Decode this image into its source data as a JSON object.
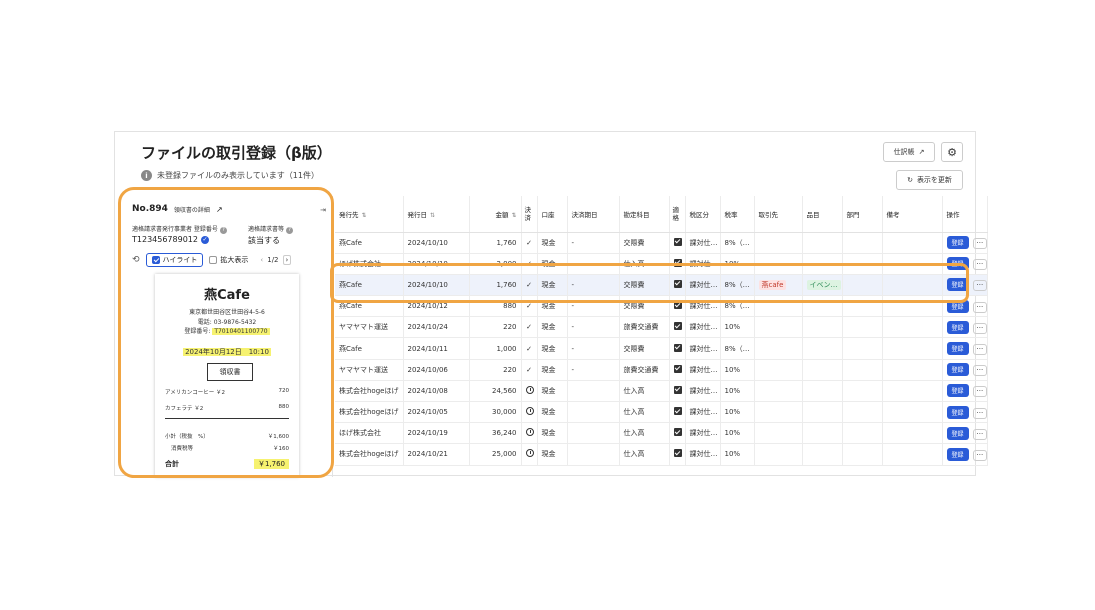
{
  "header": {
    "title": "ファイルの取引登録（β版）",
    "subtitle": "未登録ファイルのみ表示しています（11件）",
    "journal_button": "仕訳帳",
    "refresh_button": "表示を更新"
  },
  "detail": {
    "number": "No.894",
    "receipt_detail": "領収書の詳細",
    "label_issuer_reg": "適格請求書発行事業者 登録番号",
    "label_qualified": "適格請求書等",
    "reg_number": "T123456789012",
    "qualified_value": "該当する",
    "highlight_label": "ハイライト",
    "zoom_label": "拡大表示",
    "page": "1/2"
  },
  "receipt": {
    "store": "燕Cafe",
    "address": "東京都世田谷区世田谷4-5-6",
    "phone": "電話: 03-9876-5432",
    "reg_label": "登録番号:",
    "reg_value": "T7010401100770",
    "date": "2024年10月12日　10:10",
    "title": "領収書",
    "items": [
      {
        "name": "アメリカンコーヒー ￥2",
        "price": "720"
      },
      {
        "name": "カフェラテ ￥2",
        "price": "880"
      }
    ],
    "subtotal_label": "小計（税抜　%）",
    "subtotal": "￥1,600",
    "tax_label": "消費税等",
    "tax": "￥160",
    "total_label": "合計",
    "total": "￥1,760"
  },
  "table": {
    "headers": [
      "発行先",
      "発行日",
      "金額",
      "決済",
      "口座",
      "決済期日",
      "勘定科目",
      "適格",
      "税区分",
      "税率",
      "取引先",
      "品目",
      "部門",
      "備考",
      "操作"
    ],
    "rows": [
      {
        "issuer": "燕Cafe",
        "date": "2024/10/10",
        "amount": "1,760",
        "account": "現金",
        "due": "-",
        "subject": "交際費",
        "tax_cat": "課対仕…",
        "rate": "8%（…",
        "partner": "",
        "item": ""
      },
      {
        "issuer": "ほげ株式会社",
        "date": "2024/10/10",
        "amount": "2,000",
        "account": "現金",
        "due": "-",
        "subject": "仕入高",
        "tax_cat": "課対仕…",
        "rate": "10%",
        "partner": "",
        "item": ""
      },
      {
        "issuer": "燕Cafe",
        "date": "2024/10/10",
        "amount": "1,760",
        "account": "現金",
        "due": "-",
        "subject": "交際費",
        "tax_cat": "課対仕…",
        "rate": "8%（…",
        "partner": "燕cafe",
        "item": "イベン…"
      },
      {
        "issuer": "燕Cafe",
        "date": "2024/10/12",
        "amount": "880",
        "account": "現金",
        "due": "-",
        "subject": "交際費",
        "tax_cat": "課対仕…",
        "rate": "8%（…",
        "partner": "",
        "item": ""
      },
      {
        "issuer": "ヤマヤマト運送",
        "date": "2024/10/24",
        "amount": "220",
        "account": "現金",
        "due": "-",
        "subject": "旅費交通費",
        "tax_cat": "課対仕…",
        "rate": "10%",
        "partner": "",
        "item": ""
      },
      {
        "issuer": "燕Cafe",
        "date": "2024/10/11",
        "amount": "1,000",
        "account": "現金",
        "due": "-",
        "subject": "交際費",
        "tax_cat": "課対仕…",
        "rate": "8%（…",
        "partner": "",
        "item": ""
      },
      {
        "issuer": "ヤマヤマト運送",
        "date": "2024/10/06",
        "amount": "220",
        "account": "現金",
        "due": "-",
        "subject": "旅費交通費",
        "tax_cat": "課対仕…",
        "rate": "10%",
        "partner": "",
        "item": ""
      },
      {
        "issuer": "株式会社hogeほげ",
        "date": "2024/10/08",
        "amount": "24,560",
        "account": "現金",
        "due": "",
        "subject": "仕入高",
        "tax_cat": "課対仕…",
        "rate": "10%",
        "partner": "",
        "item": ""
      },
      {
        "issuer": "株式会社hogeほげ",
        "date": "2024/10/05",
        "amount": "30,000",
        "account": "現金",
        "due": "",
        "subject": "仕入高",
        "tax_cat": "課対仕…",
        "rate": "10%",
        "partner": "",
        "item": ""
      },
      {
        "issuer": "ほげ株式会社",
        "date": "2024/10/19",
        "amount": "36,240",
        "account": "現金",
        "due": "",
        "subject": "仕入高",
        "tax_cat": "課対仕…",
        "rate": "10%",
        "partner": "",
        "item": ""
      },
      {
        "issuer": "株式会社hogeほげ",
        "date": "2024/10/21",
        "amount": "25,000",
        "account": "現金",
        "due": "",
        "subject": "仕入高",
        "tax_cat": "課対仕…",
        "rate": "10%",
        "partner": "",
        "item": ""
      }
    ],
    "row_settlement": [
      "check",
      "check",
      "check",
      "check",
      "check",
      "check",
      "check",
      "clock",
      "clock",
      "clock",
      "clock"
    ],
    "register_label": "登録",
    "more_label": "···"
  }
}
